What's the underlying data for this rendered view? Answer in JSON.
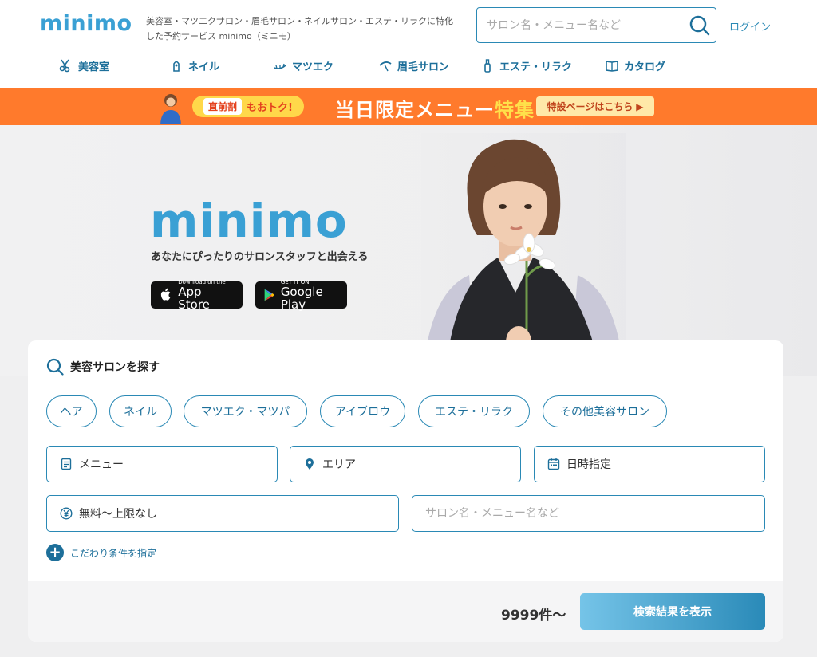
{
  "header": {
    "logo": "minimo",
    "tagline": "美容室・マツエクサロン・眉毛サロン・ネイルサロン・エステ・リラクに特化した予約サービス minimo（ミニモ）",
    "search": {
      "placeholder": "サロン名・メニュー名など",
      "icon": "search-icon"
    },
    "login": "ログイン",
    "nav": [
      {
        "label": "美容室",
        "icon": "scissors-icon"
      },
      {
        "label": "ネイル",
        "icon": "nail-icon"
      },
      {
        "label": "マツエク",
        "icon": "eyelash-icon"
      },
      {
        "label": "眉毛サロン",
        "icon": "eyebrow-icon"
      },
      {
        "label": "エステ・リラク",
        "icon": "bottle-icon"
      },
      {
        "label": "カタログ",
        "icon": "book-icon"
      }
    ]
  },
  "promo": {
    "tag": "直前割",
    "pill_text": "もおトク!",
    "title_pre": "当日限定メニュー",
    "title_hl": "特集",
    "cta": "特設ページはこちら"
  },
  "hero": {
    "logo": "minimo",
    "catch": "あなたにぴったりのサロンスタッフと出会える",
    "app_store": {
      "small": "Download on the",
      "big": "App Store"
    },
    "google_play": {
      "small": "GET IT ON",
      "big": "Google Play"
    }
  },
  "panel": {
    "title": "美容サロンを探す",
    "chips": [
      "ヘア",
      "ネイル",
      "マツエク・マツパ",
      "アイブロウ",
      "エステ・リラク",
      "その他美容サロン"
    ],
    "fields": {
      "menu": "メニュー",
      "area": "エリア",
      "date": "日時指定",
      "price": "無料〜上限なし",
      "keyword_placeholder": "サロン名・メニュー名など"
    },
    "more": "こだわり条件を指定",
    "count": "9999件〜",
    "submit": "検索結果を表示"
  },
  "colors": {
    "brand": "#3aa0d4",
    "accent": "#2a89b5",
    "promo": "#ff7a2c"
  }
}
